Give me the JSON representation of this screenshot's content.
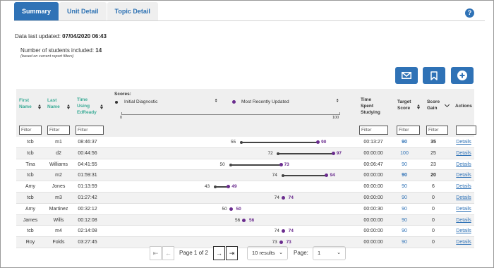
{
  "tabs": [
    {
      "label": "Summary",
      "active": true
    },
    {
      "label": "Unit Detail",
      "active": false
    },
    {
      "label": "Topic Detail",
      "active": false
    }
  ],
  "help_label": "?",
  "data_updated": {
    "label": "Data last updated:",
    "value": "07/04/2020 06:43"
  },
  "students": {
    "label": "Number of students included:",
    "value": "14",
    "note": "(based on current report filters)"
  },
  "action_buttons": [
    {
      "name": "email-button",
      "icon": "envelope-icon"
    },
    {
      "name": "bookmark-button",
      "icon": "bookmark-icon"
    },
    {
      "name": "add-button",
      "icon": "plus-icon"
    }
  ],
  "columns": {
    "first_name": "First Name",
    "last_name": "Last Name",
    "time_using": "Time Using EdReady",
    "scores": "Scores:",
    "initial": "Initial Diagnostic",
    "recent": "Most Recently Updated",
    "axis_min": "0",
    "axis_max": "100",
    "time_spent": "Time Spent Studying",
    "target_score": "Target Score",
    "score_gain": "Score Gain",
    "actions": "Actions"
  },
  "filter_placeholder": "Filter",
  "accent_color": "#2f72b6",
  "score_color": "#6a2c8e",
  "rows": [
    {
      "first": "tcb",
      "last": "m1",
      "time": "08:46:37",
      "initial": 55,
      "recent": 90,
      "spent": "00:13:27",
      "target": "90",
      "target_bold": true,
      "gain": "35",
      "gain_bold": true,
      "action": "Details"
    },
    {
      "first": "tcb",
      "last": "d2",
      "time": "00:44:56",
      "initial": 72,
      "recent": 97,
      "spent": "00:00:00",
      "target": "100",
      "target_bold": false,
      "gain": "25",
      "gain_bold": false,
      "action": "Details"
    },
    {
      "first": "Tina",
      "last": "Williams",
      "time": "04:41:55",
      "initial": 50,
      "recent": 73,
      "spent": "00:06:47",
      "target": "90",
      "target_bold": false,
      "gain": "23",
      "gain_bold": false,
      "action": "Details"
    },
    {
      "first": "tcb",
      "last": "m2",
      "time": "01:59:31",
      "initial": 74,
      "recent": 94,
      "spent": "00:00:00",
      "target": "90",
      "target_bold": true,
      "gain": "20",
      "gain_bold": true,
      "action": "Details"
    },
    {
      "first": "Amy",
      "last": "Jones",
      "time": "01:13:59",
      "initial": 43,
      "recent": 49,
      "spent": "00:00:00",
      "target": "90",
      "target_bold": false,
      "gain": "6",
      "gain_bold": false,
      "action": "Details"
    },
    {
      "first": "tcb",
      "last": "m3",
      "time": "01:27:42",
      "initial": 74,
      "recent": 74,
      "spent": "00:00:00",
      "target": "90",
      "target_bold": false,
      "gain": "0",
      "gain_bold": false,
      "action": "Details"
    },
    {
      "first": "Amy",
      "last": "Martinez",
      "time": "00:32:12",
      "initial": 50,
      "recent": 50,
      "spent": "00:00:30",
      "target": "90",
      "target_bold": false,
      "gain": "0",
      "gain_bold": false,
      "action": "Details"
    },
    {
      "first": "James",
      "last": "Wills",
      "time": "00:12:08",
      "initial": 56,
      "recent": 56,
      "spent": "00:00:00",
      "target": "90",
      "target_bold": false,
      "gain": "0",
      "gain_bold": false,
      "action": "Details"
    },
    {
      "first": "tcb",
      "last": "m4",
      "time": "02:14:08",
      "initial": 74,
      "recent": 74,
      "spent": "00:00:00",
      "target": "90",
      "target_bold": false,
      "gain": "0",
      "gain_bold": false,
      "action": "Details"
    },
    {
      "first": "Roy",
      "last": "Folds",
      "time": "03:27:45",
      "initial": 73,
      "recent": 73,
      "spent": "00:00:00",
      "target": "90",
      "target_bold": false,
      "gain": "0",
      "gain_bold": false,
      "action": "Details"
    }
  ],
  "pagination": {
    "first": "⇤",
    "prev": "←",
    "page_text": "Page 1 of 2",
    "next": "→",
    "last": "⇥",
    "results": "10 results",
    "page_label": "Page:",
    "page_value": "1"
  }
}
